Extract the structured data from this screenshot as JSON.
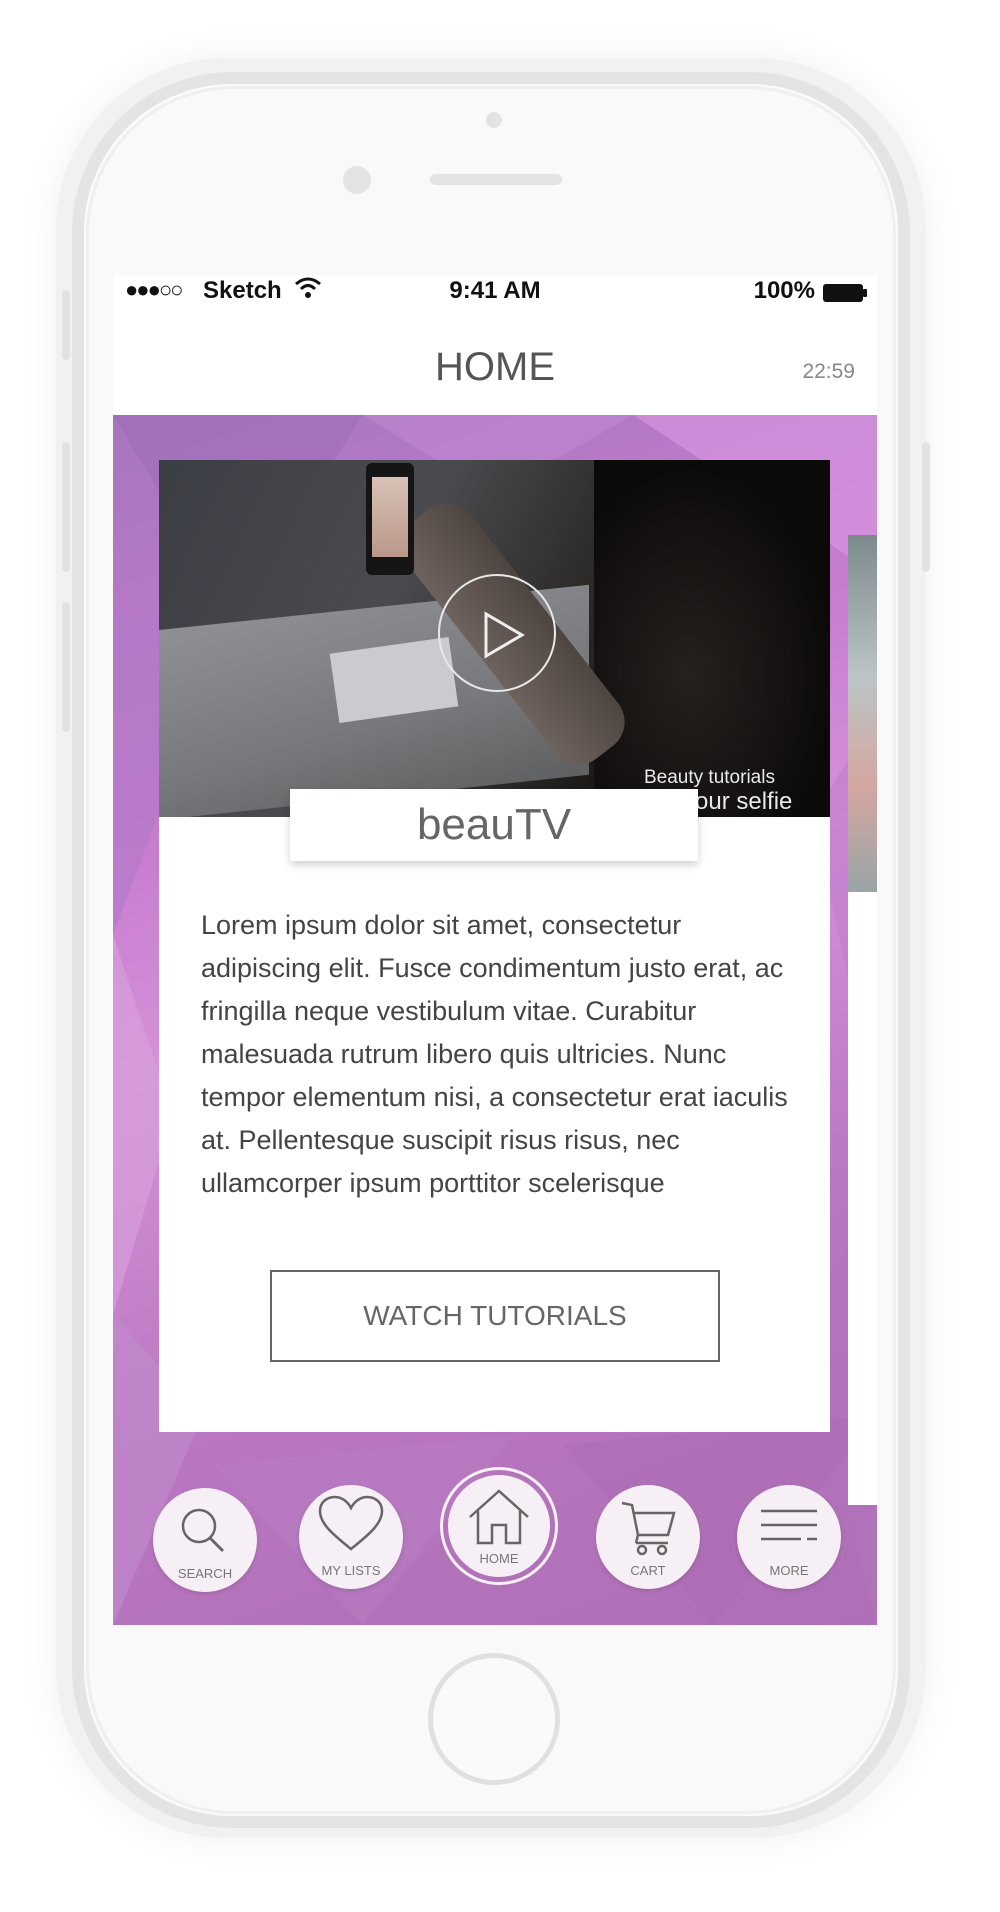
{
  "status_bar": {
    "signal": "●●●○○",
    "carrier": "Sketch",
    "time": "9:41 AM",
    "battery": "100%"
  },
  "nav": {
    "title": "HOME",
    "timer": "22:59"
  },
  "video": {
    "caption_small": "Beauty tutorials",
    "caption_large": "our selfie"
  },
  "card": {
    "title": "beauTV",
    "body": "Lorem ipsum dolor sit amet, consectetur adipiscing elit. Fusce condimentum justo erat, ac fringilla neque vestibulum vitae. Curabitur malesuada rutrum libero quis ultricies. Nunc tempor elementum nisi, a consectetur erat iaculis at. Pellentesque suscipit risus risus, nec ullamcorper ipsum porttitor scelerisque",
    "button": "WATCH TUTORIALS"
  },
  "tabbar": {
    "search": "SEARCH",
    "my_lists": "MY LISTS",
    "home": "HOME",
    "cart": "CART",
    "more": "MORE"
  },
  "colors": {
    "accent_purple": "#c77dd0",
    "tab_bg": "#f6eff6"
  },
  "icons": [
    "search-icon",
    "heart-icon",
    "home-icon",
    "cart-icon",
    "menu-icon",
    "play-icon",
    "wifi-icon",
    "battery-icon"
  ]
}
